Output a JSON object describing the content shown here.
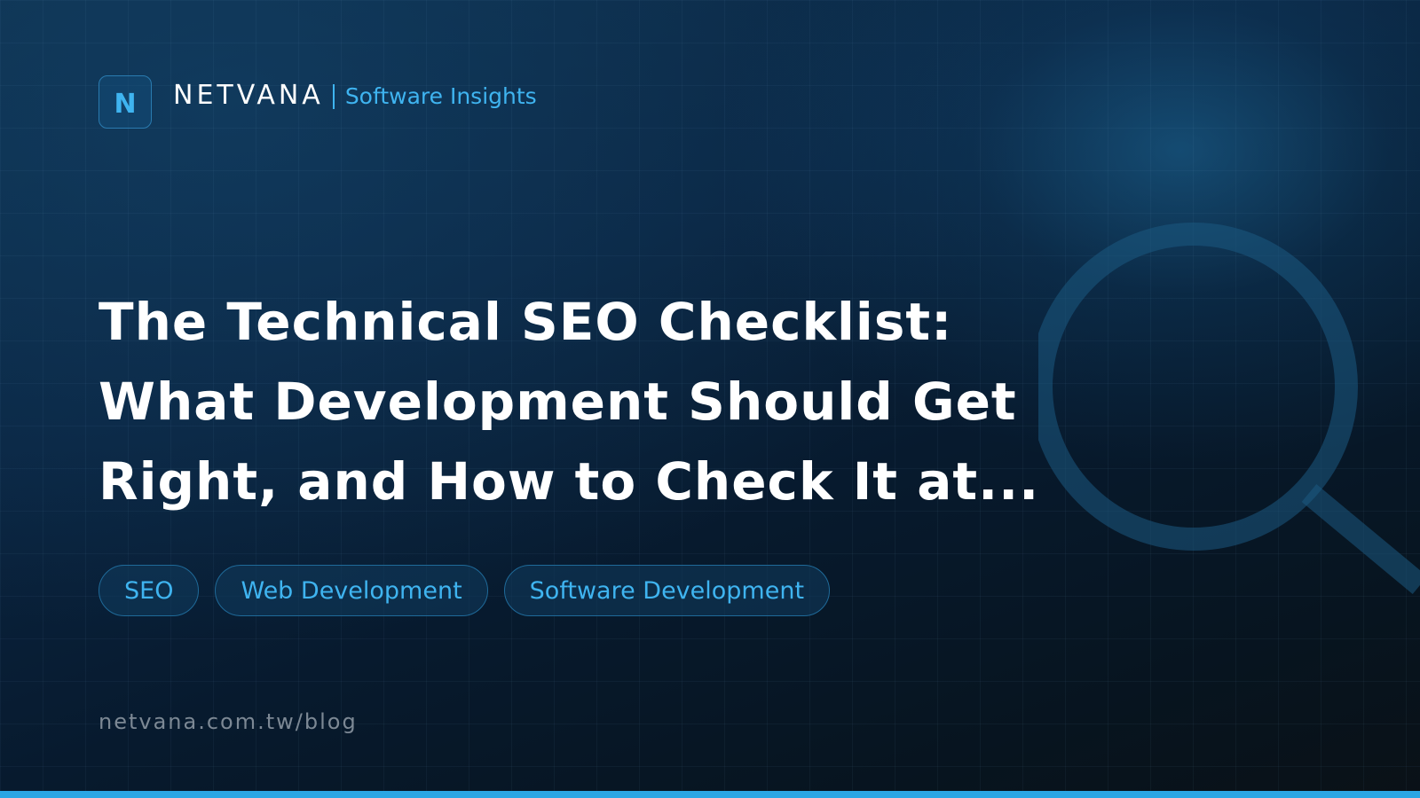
{
  "brand": {
    "logo_letter": "N",
    "name": "NETVANA",
    "section": "Software Insights"
  },
  "headline": {
    "lines": [
      "The Technical SEO Checklist:",
      "What Development Should Get",
      "Right, and How to Check It at..."
    ]
  },
  "tags": [
    "SEO",
    "Web Development",
    "Software Development"
  ],
  "footer": {
    "url": "netvana.com.tw/blog"
  },
  "decor": {
    "background_icon": "magnifier-icon"
  },
  "colors": {
    "background_dark": "#071a2c",
    "accent": "#3fb4f0",
    "accent_bar": "#2ba6e4",
    "headline": "#ffffff",
    "muted_text": "#7c8894"
  }
}
